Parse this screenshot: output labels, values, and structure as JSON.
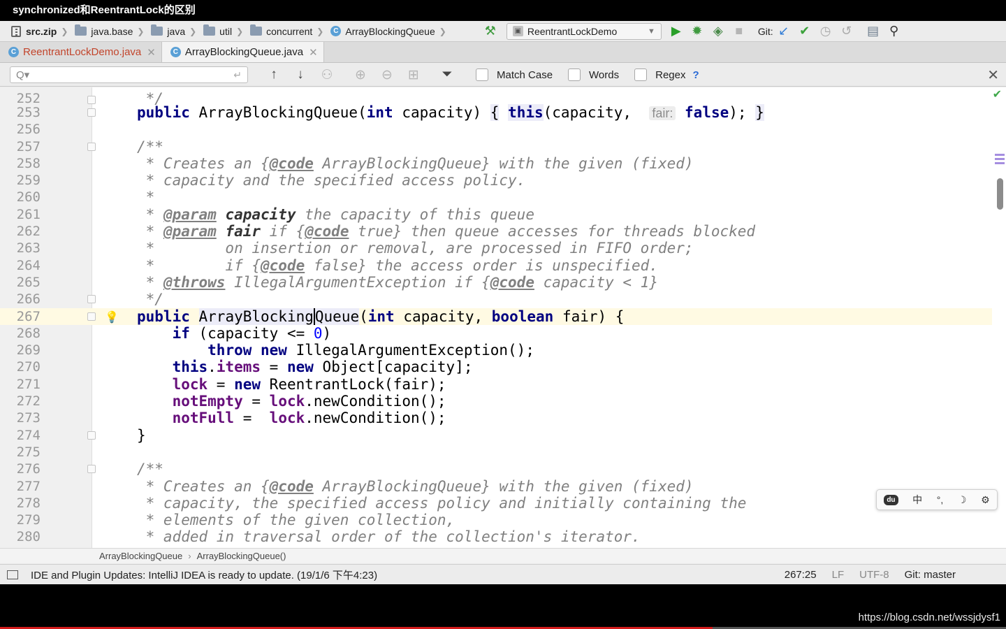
{
  "window": {
    "title": "synchronized和ReentrantLock的区别"
  },
  "navbar": {
    "crumbs": [
      "src.zip",
      "java.base",
      "java",
      "util",
      "concurrent",
      "ArrayBlockingQueue"
    ],
    "run_config": "ReentrantLockDemo",
    "git_label": "Git:"
  },
  "tabs": [
    {
      "label": "ReentrantLockDemo.java",
      "active": false
    },
    {
      "label": "ArrayBlockingQueue.java",
      "active": true
    }
  ],
  "find": {
    "placeholder": "Q▾",
    "match_case": "Match Case",
    "words": "Words",
    "regex": "Regex",
    "help": "?"
  },
  "editor": {
    "line_numbers": [
      "252",
      "253",
      "256",
      "257",
      "258",
      "259",
      "260",
      "261",
      "262",
      "263",
      "264",
      "265",
      "266",
      "267",
      "268",
      "269",
      "270",
      "271",
      "272",
      "273",
      "274",
      "275",
      "276",
      "277",
      "278",
      "279",
      "280"
    ],
    "hint_fair": "fair:"
  },
  "ime": {
    "logo": "du",
    "lang": "中",
    "punct": "°,",
    "moon": "☽",
    "gear": "⚙"
  },
  "breadcrumb": {
    "class_name": "ArrayBlockingQueue",
    "method": "ArrayBlockingQueue()"
  },
  "status": {
    "message": "IDE and Plugin Updates: IntelliJ IDEA is ready to update. (19/1/6 下午4:23)",
    "position": "267:25",
    "line_sep": "LF",
    "encoding": "UTF-8",
    "branch": "Git: master"
  },
  "watermark": "https://blog.csdn.net/wssjdysf1"
}
